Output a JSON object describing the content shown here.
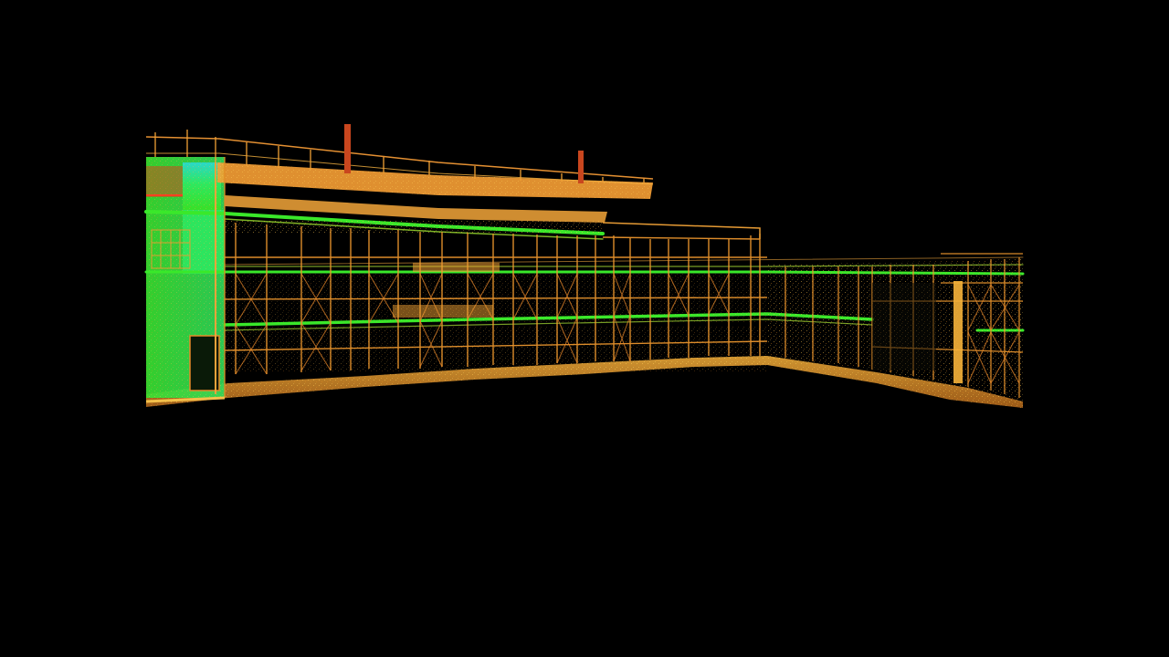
{
  "scene": {
    "background_color": "#000000",
    "palette": {
      "orange": "#f5a030",
      "orange_dim": "#b8651c",
      "yellow": "#f7d548",
      "green": "#39e82a",
      "lime": "#9ce030",
      "cyan": "#29c8d8",
      "red": "#d23a1a"
    }
  }
}
